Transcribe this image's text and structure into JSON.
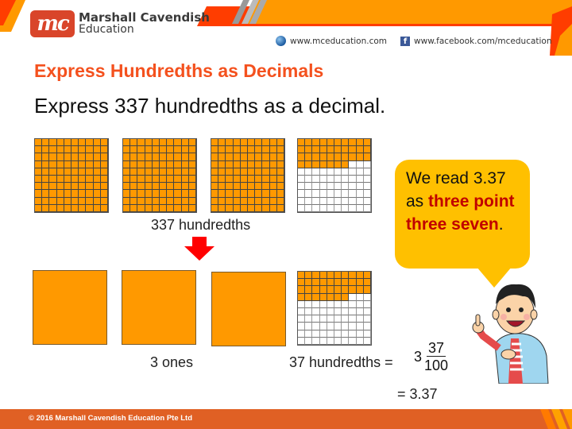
{
  "header": {
    "brand_line1": "Marshall Cavendish",
    "brand_line2": "Education",
    "logo_text": "mc",
    "website": "www.mceducation.com",
    "facebook": "www.facebook.com/mceducation",
    "colors": {
      "orange": "#ff9900",
      "red": "#ff3d00",
      "logo_red": "#d9452a"
    }
  },
  "slide": {
    "title": "Express Hundredths as Decimals",
    "question": "Express 337 hundredths as a decimal."
  },
  "top_row": {
    "grids_filled": [
      100,
      100,
      100,
      37
    ],
    "label": "337 hundredths"
  },
  "bottom_row": {
    "ones_count": 3,
    "partial_grid_filled": 37,
    "ones_label": "3 ones",
    "hundredths_label": "37 hundredths =",
    "mixed_whole": "3",
    "mixed_numerator": "37",
    "mixed_denominator": "100",
    "result": "= 3.37"
  },
  "bubble": {
    "line1": "We read 3.37",
    "as": "as ",
    "highlight": "three point three seven",
    "end": "."
  },
  "footer": {
    "copyright": "© 2016 Marshall Cavendish Education Pte Ltd"
  }
}
